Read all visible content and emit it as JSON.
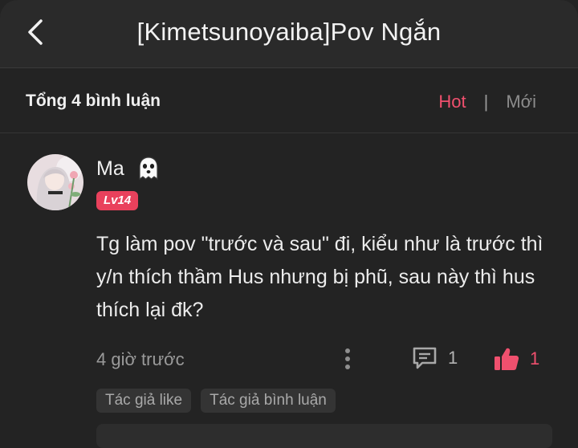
{
  "header": {
    "title": "[Kimetsunoyaiba]Pov Ngắn",
    "back_icon": "chevron-left-icon"
  },
  "summary": {
    "total_label": "Tổng 4 bình luận",
    "sort_options": [
      "Hot",
      "Mới"
    ],
    "active_sort": "Hot",
    "accent_color": "#f0506e"
  },
  "comment": {
    "username": "Ma",
    "username_emoji": "ghost-icon",
    "level": "Lv14",
    "text": "Tg làm pov \"trước và sau\" đi, kiểu như là trước thì y/n thích thầm Hus nhưng bị phũ, sau này thì hus thích lại đk?",
    "time": "4 giờ trước",
    "reply_count": "1",
    "like_count": "1",
    "tags": [
      "Tác giả like",
      "Tác giả bình luận"
    ]
  }
}
